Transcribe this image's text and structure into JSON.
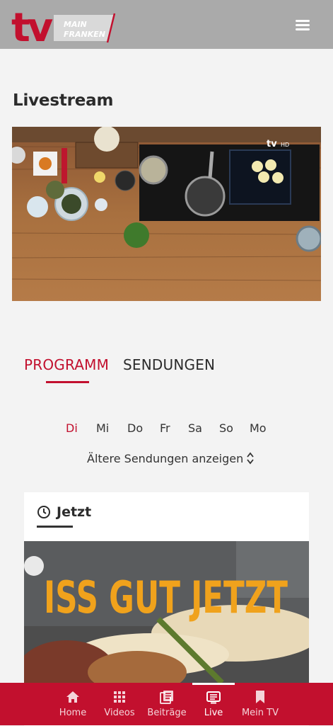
{
  "header": {
    "logo": {
      "mark": "tv",
      "line1": "MAIN",
      "line2": "FRANKEN"
    },
    "menu_icon": "hamburger-menu-icon"
  },
  "page": {
    "title": "Livestream"
  },
  "player": {
    "watermark": "tv",
    "watermark_suffix": "HD"
  },
  "tabs": [
    {
      "label": "PROGRAMM",
      "active": true
    },
    {
      "label": "SENDUNGEN",
      "active": false
    }
  ],
  "days": [
    {
      "label": "Di",
      "active": true
    },
    {
      "label": "Mi",
      "active": false
    },
    {
      "label": "Do",
      "active": false
    },
    {
      "label": "Fr",
      "active": false
    },
    {
      "label": "Sa",
      "active": false
    },
    {
      "label": "So",
      "active": false
    },
    {
      "label": "Mo",
      "active": false
    }
  ],
  "older_link": {
    "label": "Ältere Sendungen anzeigen",
    "icon": "chevron-up-down-icon"
  },
  "now_card": {
    "title": "Jetzt",
    "icon": "clock-icon",
    "image_headline": "ISS GUT JETZT"
  },
  "bottom_nav": [
    {
      "label": "Home",
      "icon": "home-icon",
      "active": false
    },
    {
      "label": "Videos",
      "icon": "grid-icon",
      "active": false
    },
    {
      "label": "Beiträge",
      "icon": "articles-icon",
      "active": false
    },
    {
      "label": "Live",
      "icon": "live-tv-icon",
      "active": true
    },
    {
      "label": "Mein TV",
      "icon": "bookmark-icon",
      "active": false
    }
  ],
  "colors": {
    "brand": "#c2102e",
    "header_bg": "#aaaaaa",
    "page_bg": "#f3f3f3",
    "headline_orange": "#f0a21c"
  }
}
